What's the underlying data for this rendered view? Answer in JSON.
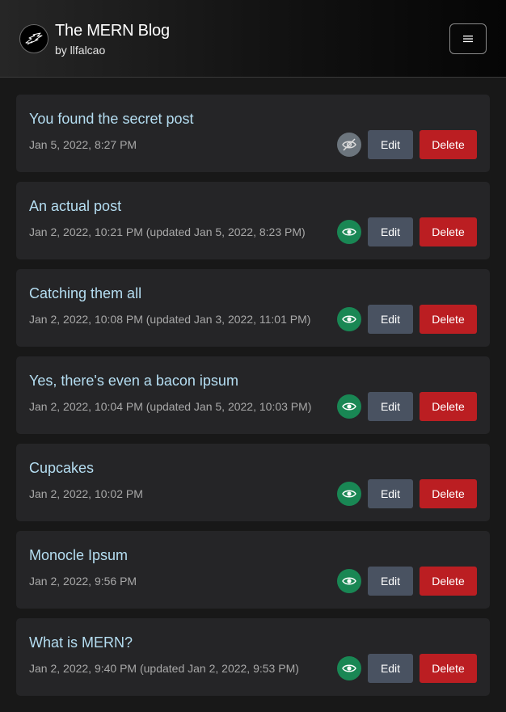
{
  "header": {
    "title": "The MERN Blog",
    "byline": "by llfalcao",
    "menu_icon": "hamburger-icon",
    "logo_icon": "bird-logo-icon"
  },
  "colors": {
    "visible": "#198754",
    "hidden": "#6c757d",
    "edit": "#495261",
    "delete": "#bb1e22",
    "title": "#b5def2"
  },
  "posts": [
    {
      "title": "You found the secret post",
      "date": "Jan 5, 2022, 8:27 PM",
      "visible": false,
      "edit_label": "Edit",
      "delete_label": "Delete"
    },
    {
      "title": "An actual post",
      "date": "Jan 2, 2022, 10:21 PM (updated Jan 5, 2022, 8:23 PM)",
      "visible": true,
      "edit_label": "Edit",
      "delete_label": "Delete"
    },
    {
      "title": "Catching them all",
      "date": "Jan 2, 2022, 10:08 PM (updated Jan 3, 2022, 11:01 PM)",
      "visible": true,
      "edit_label": "Edit",
      "delete_label": "Delete"
    },
    {
      "title": "Yes, there's even a bacon ipsum",
      "date": "Jan 2, 2022, 10:04 PM (updated Jan 5, 2022, 10:03 PM)",
      "visible": true,
      "edit_label": "Edit",
      "delete_label": "Delete"
    },
    {
      "title": "Cupcakes",
      "date": "Jan 2, 2022, 10:02 PM",
      "visible": true,
      "edit_label": "Edit",
      "delete_label": "Delete"
    },
    {
      "title": "Monocle Ipsum",
      "date": "Jan 2, 2022, 9:56 PM",
      "visible": true,
      "edit_label": "Edit",
      "delete_label": "Delete"
    },
    {
      "title": "What is MERN?",
      "date": "Jan 2, 2022, 9:40 PM (updated Jan 2, 2022, 9:53 PM)",
      "visible": true,
      "edit_label": "Edit",
      "delete_label": "Delete"
    }
  ]
}
